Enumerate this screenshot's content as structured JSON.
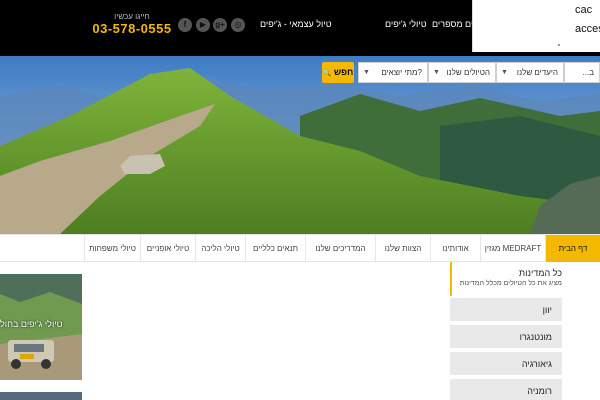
{
  "header": {
    "phone_caption": "חייגו עכשיו",
    "phone": "03-578-0555",
    "social_icons": [
      "facebook-icon",
      "youtube-icon",
      "google-plus-icon",
      "instagram-icon"
    ],
    "social_glyphs": [
      "f",
      "▶",
      "g+",
      "◎"
    ],
    "nav": [
      "טיול עצמאי - ג'יפים",
      "טיולי ג'יפים",
      "ים מספרים ♥"
    ]
  },
  "popup": {
    "line1": "cac",
    "line2": "acces"
  },
  "search": {
    "fields": [
      "...ב",
      "היעדים שלנו",
      "הטיולים שלנו",
      "מתי יוצאים?"
    ],
    "button_label": "חפש",
    "button_icon": "search-icon"
  },
  "tabs": [
    "דף הבית",
    "מגזין MEDRAFT",
    "אודותינו",
    "הצוות שלנו",
    "המדריכים שלנו",
    "תנאים כלליים",
    "טיולי הליכה",
    "טיולי אופניים",
    "טיולי משפחות"
  ],
  "sidebar": {
    "title": "כל המדינות",
    "subtitle": "מציג את כל הטיולים מכלל המדינות",
    "countries": [
      "יוון",
      "מונטנגרו",
      "גיאורגיה",
      "רומניה"
    ]
  },
  "cards": [
    {
      "caption": "טיולי ג'יפים בחול"
    }
  ],
  "colors": {
    "accent": "#f5b800",
    "topbar": "#000000"
  }
}
